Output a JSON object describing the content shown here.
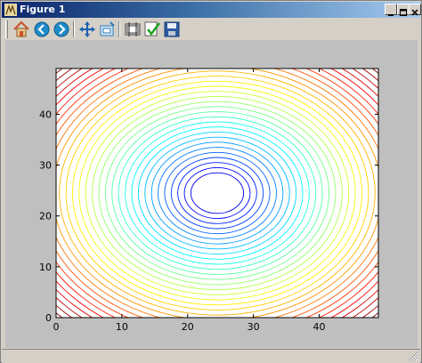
{
  "window": {
    "title": "Figure 1"
  },
  "titlebar_buttons": [
    "minimize",
    "maximize",
    "close"
  ],
  "toolbar": {
    "tools": [
      {
        "name": "home-icon",
        "color": "#c8502a"
      },
      {
        "name": "back-icon",
        "color": "#1f8bc8"
      },
      {
        "name": "forward-icon",
        "color": "#1f8bc8"
      },
      {
        "name": "pan-icon",
        "color": "#1a5fb0"
      },
      {
        "name": "zoom-icon",
        "color": "#2a7ab8"
      },
      {
        "name": "subplots-icon",
        "color": "#404040"
      },
      {
        "name": "edit-icon",
        "color": "#1aa31a"
      },
      {
        "name": "save-icon",
        "color": "#2a5aa0"
      }
    ]
  },
  "chart_data": {
    "type": "contour",
    "function": "(x - 24.5)^2 + (y - 24.5)^2",
    "x_range": [
      0,
      49
    ],
    "y_range": [
      0,
      49
    ],
    "xlim": [
      0,
      49
    ],
    "ylim": [
      0,
      49
    ],
    "xticks": [
      "0",
      "10",
      "20",
      "30",
      "40"
    ],
    "yticks": [
      "0",
      "10",
      "20",
      "30",
      "40"
    ],
    "x_tick_values": [
      0,
      10,
      20,
      30,
      40
    ],
    "y_tick_values": [
      0,
      10,
      20,
      30,
      40
    ],
    "contour_levels_sqrt": [
      4,
      5,
      6,
      7,
      8,
      9,
      10,
      11,
      12,
      13,
      14,
      15,
      16,
      17,
      18,
      19,
      20,
      21,
      22,
      23,
      24,
      25,
      26,
      27,
      28,
      29,
      30,
      31,
      32,
      33,
      34
    ],
    "colormap": "jet",
    "center": [
      24.5,
      24.5
    ],
    "title": "",
    "xlabel": "",
    "ylabel": "",
    "grid": false
  }
}
